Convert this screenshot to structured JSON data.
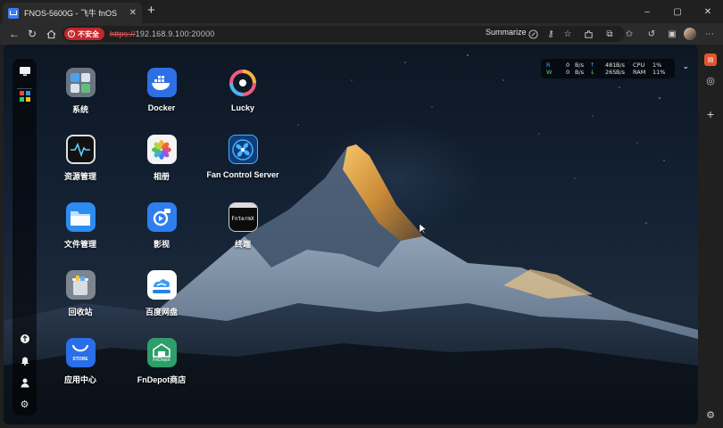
{
  "browser": {
    "tab_title": "FNOS-5600G - 飞牛 fnOS",
    "tab_close": "✕",
    "new_tab": "+",
    "window_controls": [
      "–",
      "▢",
      "✕"
    ],
    "insecure_label": "不安全",
    "url_scheme": "https://",
    "url_rest": "192.168.9.100:20000",
    "summarize_label": "Summarize"
  },
  "monitor": {
    "r_label": "R",
    "w_label": "W",
    "r_value": "0",
    "r_unit": "B/s",
    "w_value": "0",
    "w_unit": "B/s",
    "up_value": "481",
    "up_unit": "B/s",
    "down_value": "265",
    "down_unit": "B/s",
    "cpu_label": "CPU",
    "cpu_value": "1%",
    "ram_label": "RAM",
    "ram_value": "11%"
  },
  "apps": [
    {
      "label": "系统"
    },
    {
      "label": "Docker"
    },
    {
      "label": "Lucky"
    },
    {
      "label": "资源管理"
    },
    {
      "label": "相册"
    },
    {
      "label": "Fan Control Server"
    },
    {
      "label": "文件管理"
    },
    {
      "label": "影视"
    },
    {
      "label": "终端"
    },
    {
      "label": "回收站"
    },
    {
      "label": "百度网盘"
    },
    {
      "label": "应用中心"
    },
    {
      "label": "FnDepot商店"
    }
  ],
  "icon_text": {
    "terminal": "FntermX",
    "store": "STORE",
    "fndepot": "FnDepot"
  },
  "colors": {
    "insecure": "#c3262b",
    "docker": "#2f6fe6",
    "files": "#2d8cf0",
    "store": "#2a6ee8",
    "fndepot": "#2e9e6b"
  }
}
